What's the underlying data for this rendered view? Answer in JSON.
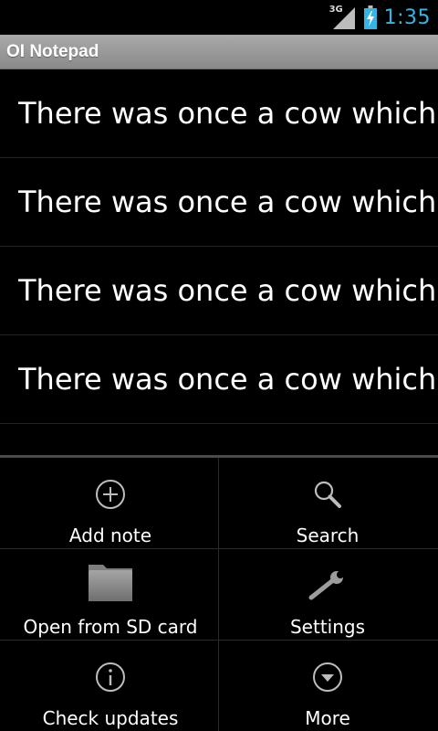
{
  "status_bar": {
    "network": "3G",
    "time": "1:35",
    "icons": [
      "signal-icon",
      "battery-charging-icon"
    ],
    "clock_color": "#33b5e5"
  },
  "app": {
    "title": "OI Notepad"
  },
  "notes": [
    {
      "text": "There was once a cow which"
    },
    {
      "text": "There was once a cow which"
    },
    {
      "text": "There was once a cow which"
    },
    {
      "text": "There was once a cow which"
    }
  ],
  "menu": {
    "add_note": {
      "label": "Add note",
      "icon": "add-circle-icon"
    },
    "search": {
      "label": "Search",
      "icon": "search-icon"
    },
    "open_sd": {
      "label": "Open from SD card",
      "icon": "folder-icon"
    },
    "settings": {
      "label": "Settings",
      "icon": "wrench-icon"
    },
    "check_updates": {
      "label": "Check updates",
      "icon": "info-icon"
    },
    "more": {
      "label": "More",
      "icon": "chevron-down-circle-icon"
    }
  }
}
